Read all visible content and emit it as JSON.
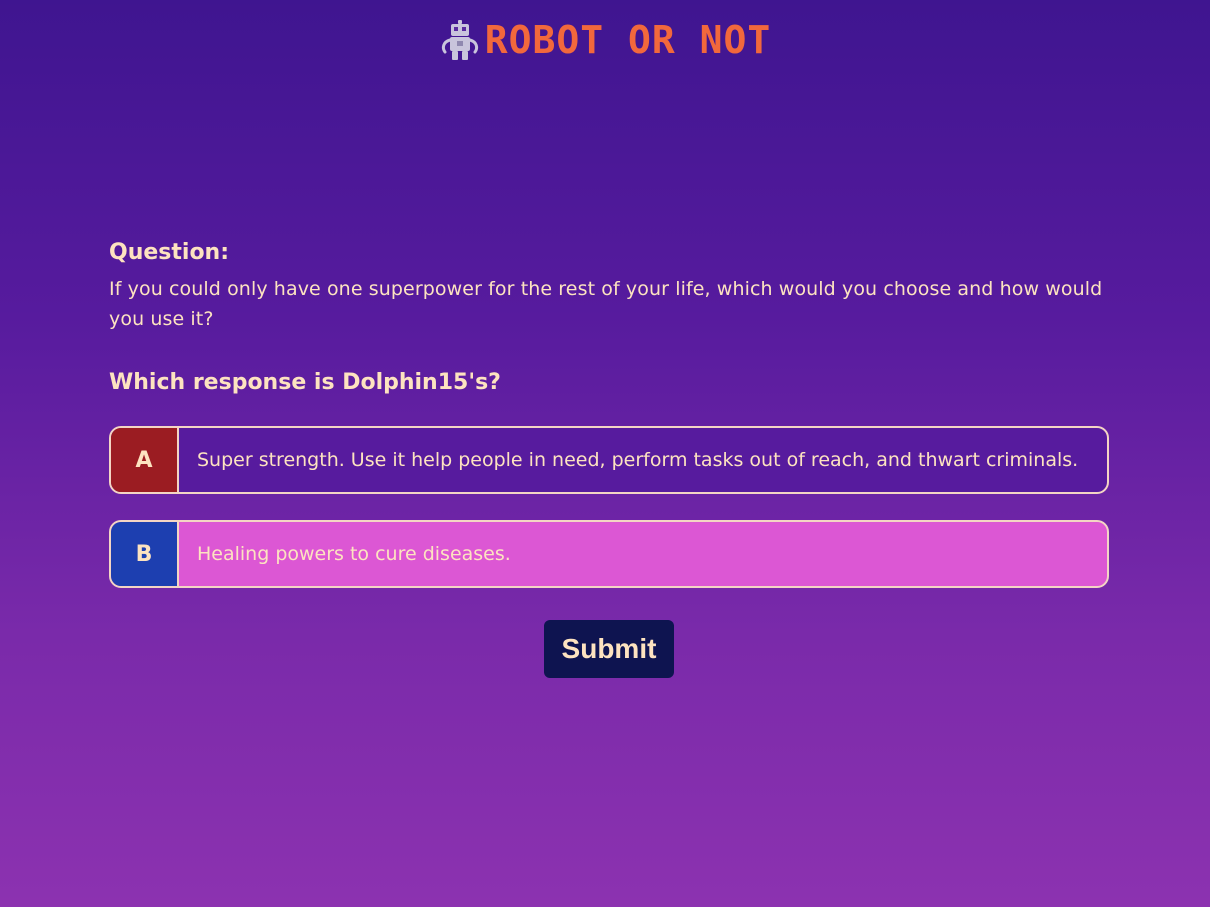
{
  "header": {
    "logo_icon": "robot-icon",
    "title": "ROBOT OR NOT"
  },
  "question": {
    "label": "Question:",
    "text": "If you could only have one superpower for the rest of your life, which would you choose and how would you use it?"
  },
  "prompt": "Which response is Dolphin15's?",
  "options": [
    {
      "letter": "A",
      "text": "Super strength. Use it help people in need, perform tasks out of reach, and thwart criminals.",
      "letter_color": "#9b1c22",
      "selected": false
    },
    {
      "letter": "B",
      "text": "Healing powers to cure diseases.",
      "letter_color": "#1d3fb0",
      "selected": true
    }
  ],
  "submit_label": "Submit",
  "colors": {
    "title": "#f2683c",
    "text": "#fde3c0",
    "selected_bg": "#dc57d4",
    "submit_bg": "#0e1450"
  }
}
